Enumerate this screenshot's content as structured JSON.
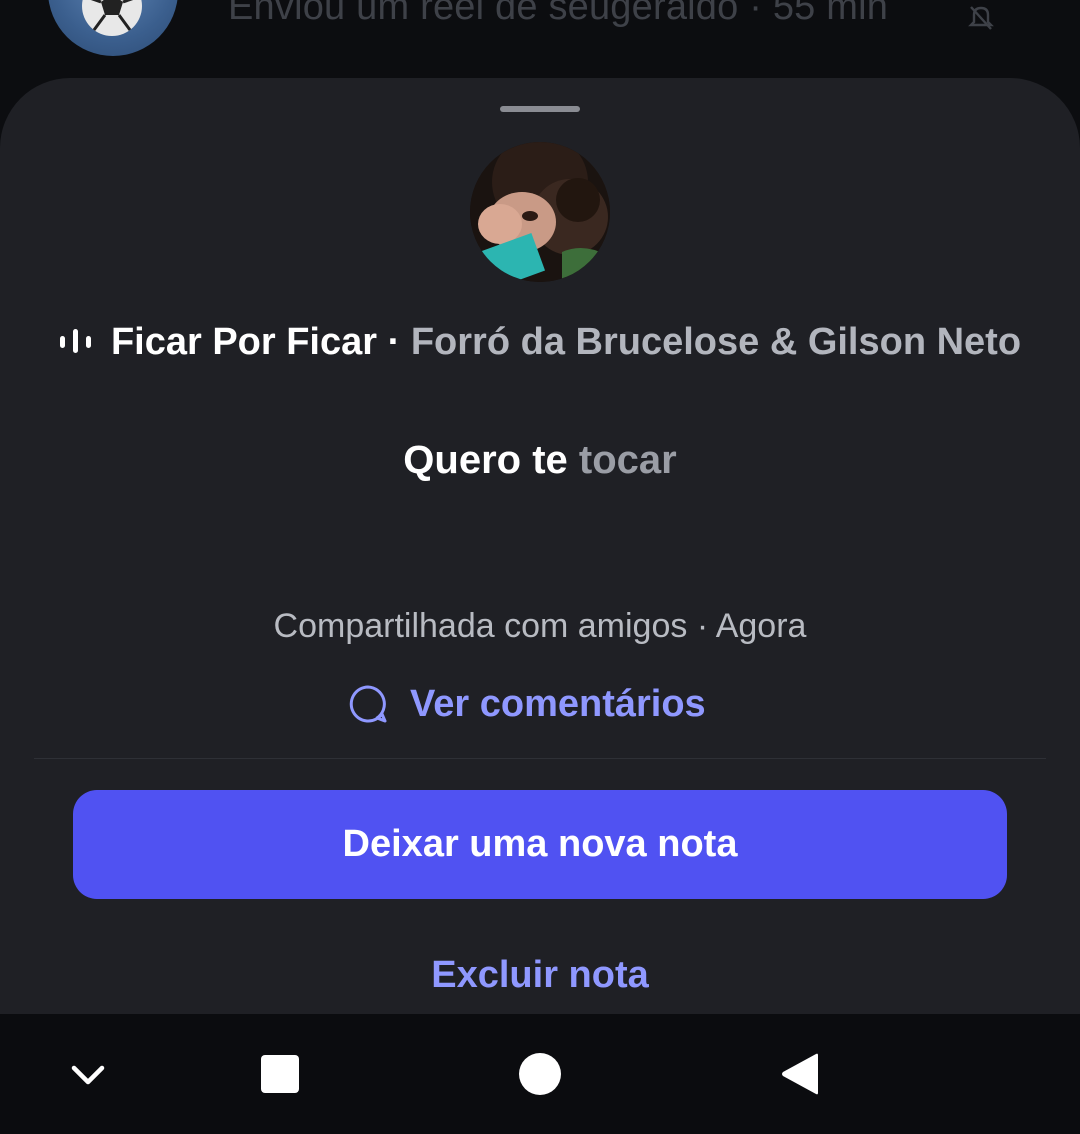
{
  "background_row": {
    "text": "Enviou um reel de seugeraldo · 55 min",
    "avatar_icon": "soccer-ball-icon",
    "muted_icon": "bell-off-icon"
  },
  "note": {
    "music": {
      "icon": "audio-bars-icon",
      "title": "Ficar Por Ficar",
      "separator": " · ",
      "artist": "Forró da Brucelose & Gilson Neto"
    },
    "lyric_highlighted": "Quero te",
    "lyric_upcoming": "tocar",
    "shared_info": "Compartilhada com amigos · Agora",
    "comments_label": "Ver comentários",
    "comments_icon": "comment-bubble-icon"
  },
  "actions": {
    "new_note_label": "Deixar uma nova nota",
    "delete_label": "Excluir nota"
  },
  "navbar": {
    "items": [
      "chevron-down-icon",
      "recents-square-icon",
      "home-circle-icon",
      "back-triangle-icon"
    ]
  },
  "colors": {
    "sheet_bg": "#1f2025",
    "accent": "#5052f2",
    "link": "#8f98ff"
  }
}
